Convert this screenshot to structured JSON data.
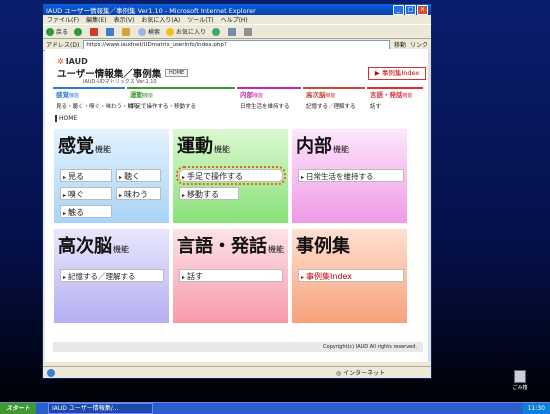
{
  "window": {
    "title": "IAUD ユーザー情報集／事例集 Ver1.10 - Microsoft Internet Explorer",
    "menu": [
      "ファイル(F)",
      "編集(E)",
      "表示(V)",
      "お気に入り(A)",
      "ツール(T)",
      "ヘルプ(H)"
    ],
    "toolbar": {
      "back": "戻る",
      "search": "検索",
      "favorites": "お気に入り"
    },
    "address_label": "アドレス(D)",
    "address": "https://www.iaudnet/UDmatrix_userinfo/index.php?",
    "go": "移動",
    "links": "リンク",
    "status_zone": "インターネット"
  },
  "page": {
    "logo": "IAUD",
    "title": "ユーザー情報集／事例集",
    "version": "IAUD-UDマトリックス Ver.1.10",
    "home_button": "HOME",
    "case_button": "事例集Index",
    "breadcrumb": "HOME",
    "footer": "Copyright(c) IAUD All rights reserved."
  },
  "nav": [
    {
      "title": "感覚",
      "suffix": "機能",
      "color": "#2e7bd6",
      "subs": "見る・聴く・嗅ぐ・味わう・触る"
    },
    {
      "title": "運動",
      "suffix": "機能",
      "color": "#3a9e2e",
      "subs": "手足で操作する・移動する"
    },
    {
      "title": "内部",
      "suffix": "機能",
      "color": "#c02ab0",
      "subs": "日常生活を維持する"
    },
    {
      "title": "高次脳",
      "suffix": "機能",
      "color": "#c84a3a",
      "subs": "記憶する／理解する"
    },
    {
      "title": "言語・発話",
      "suffix": "機能",
      "color": "#d9303a",
      "subs": "話す"
    }
  ],
  "tiles": {
    "sense": {
      "title": "感覚",
      "suffix": "機能",
      "buttons": [
        "見る",
        "聴く",
        "嗅ぐ",
        "味わう",
        "触る"
      ]
    },
    "motor": {
      "title": "運動",
      "suffix": "機能",
      "buttons": [
        "手足で操作する",
        "移動する"
      ]
    },
    "internal": {
      "title": "内部",
      "suffix": "機能",
      "buttons": [
        "日常生活を維持する"
      ]
    },
    "cognitive": {
      "title": "高次脳",
      "suffix": "機能",
      "buttons": [
        "記憶する／理解する"
      ]
    },
    "speech": {
      "title": "言語・発話",
      "suffix": "機能",
      "buttons": [
        "話す"
      ]
    },
    "cases": {
      "title": "事例集",
      "suffix": "",
      "buttons": [
        "事例集Index"
      ]
    }
  },
  "taskbar": {
    "start": "スタート",
    "task": "IAUD ユーザー情報集/...",
    "clock": "11:30"
  },
  "desktop": {
    "recycle": "ごみ箱"
  },
  "colors": {
    "sense": "#bfe0fa",
    "motor": "#a8ec9a",
    "internal": "#f6b6f0",
    "cognitive": "#c9c6f8",
    "speech": "#fbb8c4",
    "cases": "#fbb898",
    "highlight": "#e36a0a"
  }
}
